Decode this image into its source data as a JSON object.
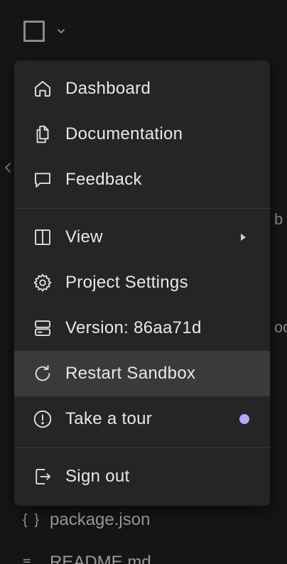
{
  "workspace": {
    "collapse_icon": "chevron-left-icon",
    "logo_icon": "square-logo-icon",
    "logo_chevron": "chevron-down-icon",
    "background_fragments": [
      "b",
      "ode"
    ],
    "files": [
      {
        "icon": "{ }",
        "name": "package.json"
      },
      {
        "icon": "≡",
        "name": "README.md"
      }
    ]
  },
  "menu": {
    "groups": [
      [
        {
          "id": "dashboard",
          "label": "Dashboard",
          "icon": "home-icon"
        },
        {
          "id": "documentation",
          "label": "Documentation",
          "icon": "documents-icon"
        },
        {
          "id": "feedback",
          "label": "Feedback",
          "icon": "message-square-icon"
        }
      ],
      [
        {
          "id": "view",
          "label": "View",
          "icon": "columns-icon",
          "submenu": true
        },
        {
          "id": "project-settings",
          "label": "Project Settings",
          "icon": "gear-icon"
        },
        {
          "id": "version",
          "label": "Version: 86aa71d",
          "icon": "server-icon"
        },
        {
          "id": "restart-sandbox",
          "label": "Restart Sandbox",
          "icon": "refresh-icon",
          "hovered": true
        },
        {
          "id": "take-a-tour",
          "label": "Take a tour",
          "icon": "alert-circle-icon",
          "badge": "new-dot"
        }
      ],
      [
        {
          "id": "sign-out",
          "label": "Sign out",
          "icon": "logout-icon"
        }
      ]
    ],
    "colors": {
      "background": "#252525",
      "hover": "#3a3a3a",
      "badge": "#b4a7f5",
      "text": "#e8e8e8"
    }
  }
}
